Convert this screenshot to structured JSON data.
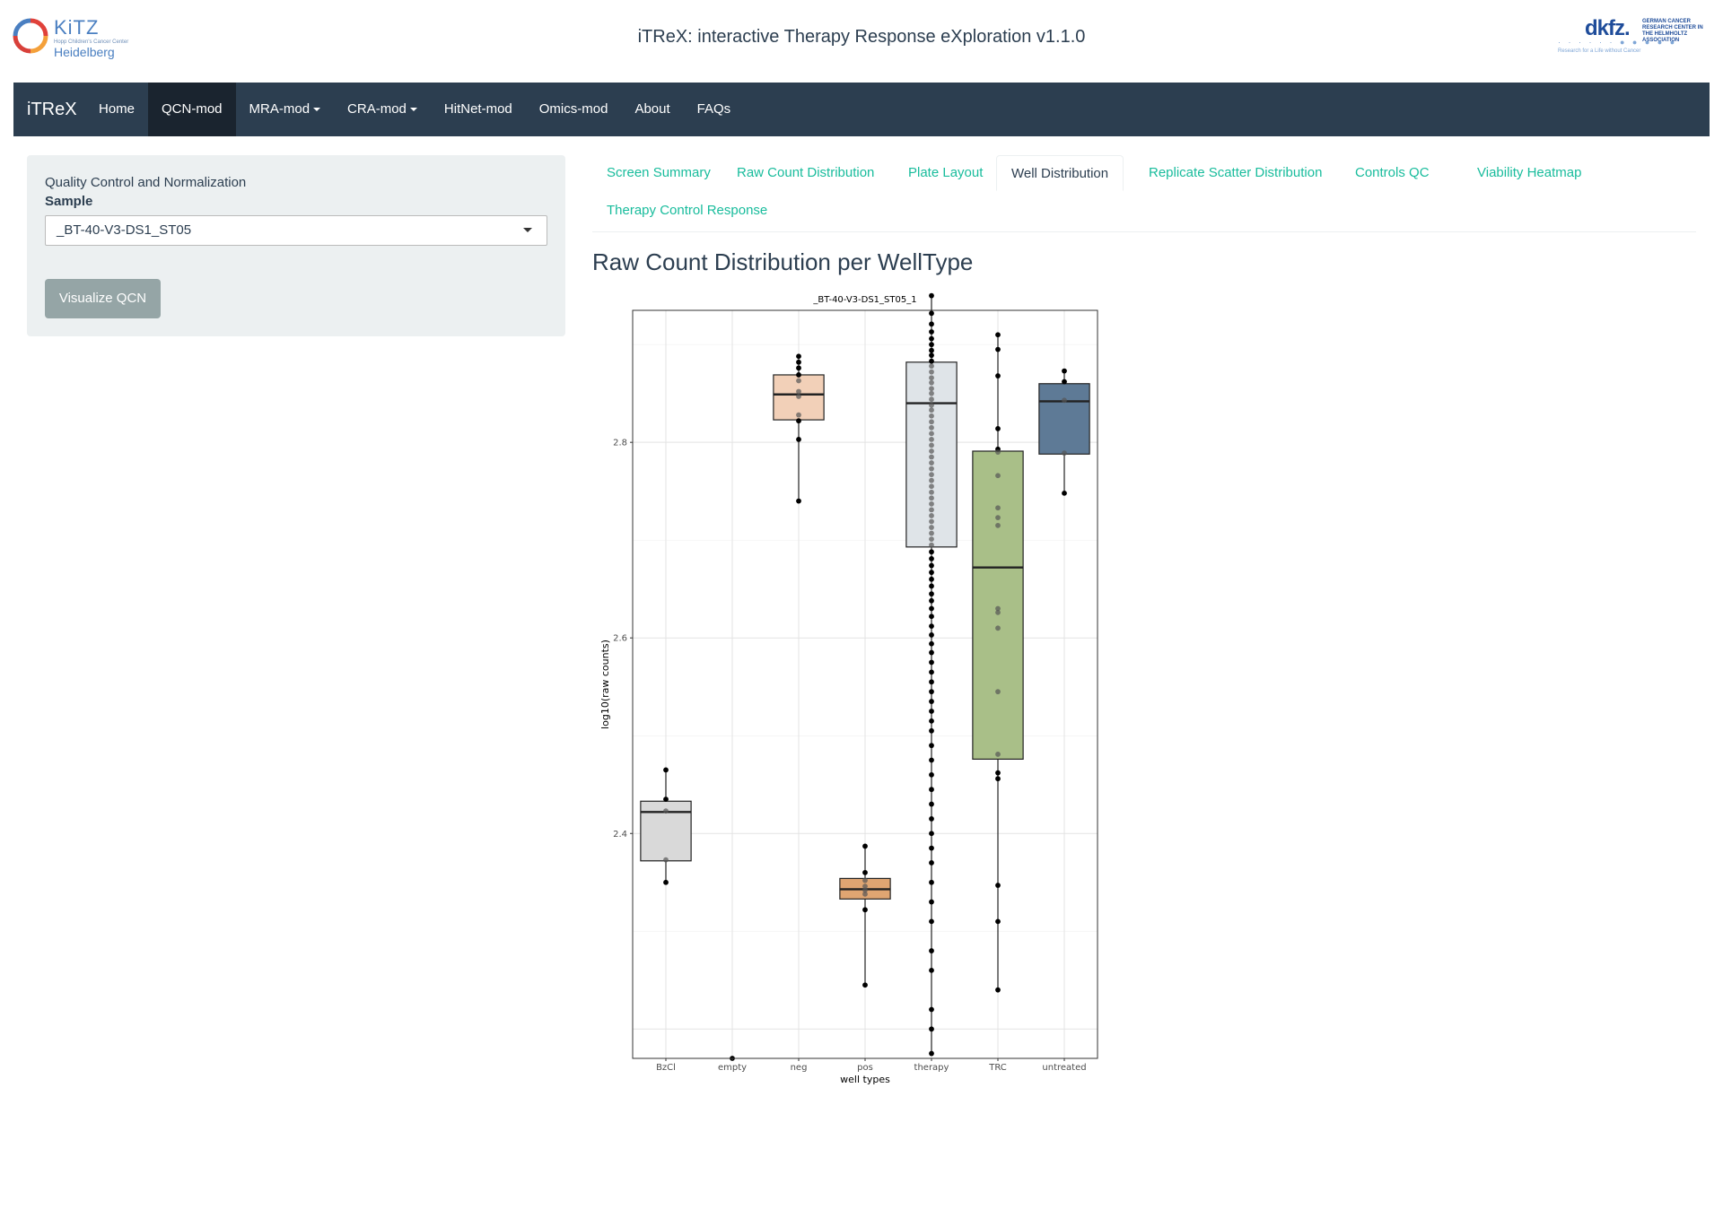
{
  "header": {
    "title": "iTReX: interactive Therapy Response eXploration v1.1.0",
    "kitz_logo": {
      "name": "KiTZ",
      "subtitle": "Hopp Children's Cancer Center",
      "city": "Heidelberg"
    },
    "dkfz_logo": {
      "name": "dkfz.",
      "org": "GERMAN CANCER RESEARCH CENTER IN THE HELMHOLTZ ASSOCIATION",
      "tagline": "Research for a Life without Cancer"
    }
  },
  "navbar": {
    "brand": "iTReX",
    "items": [
      {
        "label": "Home",
        "active": false,
        "dropdown": false
      },
      {
        "label": "QCN-mod",
        "active": true,
        "dropdown": false
      },
      {
        "label": "MRA-mod",
        "active": false,
        "dropdown": true
      },
      {
        "label": "CRA-mod",
        "active": false,
        "dropdown": true
      },
      {
        "label": "HitNet-mod",
        "active": false,
        "dropdown": false
      },
      {
        "label": "Omics-mod",
        "active": false,
        "dropdown": false
      },
      {
        "label": "About",
        "active": false,
        "dropdown": false
      },
      {
        "label": "FAQs",
        "active": false,
        "dropdown": false
      }
    ]
  },
  "sidebar": {
    "heading": "Quality Control and Normalization",
    "sample_label": "Sample",
    "sample_value": "_BT-40-V3-DS1_ST05",
    "button_label": "Visualize QCN"
  },
  "tabs": [
    {
      "label": "Screen Summary",
      "active": false
    },
    {
      "label": "Raw Count Distribution",
      "active": false
    },
    {
      "label": "Plate Layout",
      "active": false
    },
    {
      "label": "Well Distribution",
      "active": true
    },
    {
      "label": "Replicate Scatter Distribution",
      "active": false
    },
    {
      "label": "Controls QC",
      "active": false
    },
    {
      "label": "Viability Heatmap",
      "active": false
    },
    {
      "label": "Therapy Control Response",
      "active": false
    }
  ],
  "section_title": "Raw Count Distribution per WellType",
  "colors": {
    "navbar": "#2c3e50",
    "navbar_active": "#1a242f",
    "tab_link": "#18bc9c",
    "sidebar_bg": "#ecf0f1",
    "button_bg": "#95a5a6"
  },
  "chart_data": {
    "type": "box",
    "title": "_BT-40-V3-DS1_ST05_1",
    "xlabel": "well types",
    "ylabel": "log10(raw counts)",
    "ylim": [
      2.17,
      2.935
    ],
    "yticks": [
      "2.4",
      "2.6",
      "2.8"
    ],
    "grid": true,
    "categories": [
      "BzCl",
      "empty",
      "neg",
      "pos",
      "therapy",
      "TRC",
      "untreated"
    ],
    "boxes": [
      {
        "category": "BzCl",
        "whisker_low": 2.35,
        "q1": 2.372,
        "median": 2.422,
        "q3": 2.433,
        "whisker_high": 2.465,
        "color": "#d9d9d9",
        "points": [
          2.465,
          2.435,
          2.423,
          2.373,
          2.35
        ]
      },
      {
        "category": "empty",
        "points": [
          2.17
        ],
        "color": "#cccccc"
      },
      {
        "category": "neg",
        "whisker_low": 2.74,
        "q1": 2.823,
        "median": 2.849,
        "q3": 2.869,
        "whisker_high": 2.888,
        "color": "#f2d0b8",
        "points": [
          2.888,
          2.882,
          2.876,
          2.869,
          2.863,
          2.852,
          2.847,
          2.828,
          2.822,
          2.803,
          2.74
        ]
      },
      {
        "category": "pos",
        "whisker_low": 2.245,
        "q1": 2.333,
        "median": 2.343,
        "q3": 2.354,
        "whisker_high": 2.387,
        "color": "#dfa572",
        "points": [
          2.387,
          2.36,
          2.352,
          2.346,
          2.342,
          2.338,
          2.322,
          2.245
        ]
      },
      {
        "category": "therapy",
        "whisker_low": 2.175,
        "q1": 2.693,
        "median": 2.84,
        "q3": 2.882,
        "whisker_high": 2.95,
        "color": "#dfe4e8",
        "points": [
          2.95,
          2.932,
          2.921,
          2.913,
          2.906,
          2.9,
          2.894,
          2.889,
          2.883,
          2.878,
          2.872,
          2.866,
          2.861,
          2.855,
          2.85,
          2.844,
          2.838,
          2.833,
          2.827,
          2.821,
          2.815,
          2.809,
          2.803,
          2.797,
          2.791,
          2.785,
          2.779,
          2.773,
          2.767,
          2.761,
          2.755,
          2.749,
          2.743,
          2.737,
          2.731,
          2.725,
          2.719,
          2.713,
          2.707,
          2.701,
          2.695,
          2.688,
          2.681,
          2.674,
          2.667,
          2.66,
          2.653,
          2.645,
          2.638,
          2.63,
          2.622,
          2.612,
          2.603,
          2.594,
          2.585,
          2.575,
          2.565,
          2.555,
          2.545,
          2.535,
          2.525,
          2.515,
          2.505,
          2.49,
          2.475,
          2.46,
          2.445,
          2.43,
          2.415,
          2.4,
          2.385,
          2.37,
          2.35,
          2.33,
          2.31,
          2.28,
          2.26,
          2.22,
          2.2,
          2.175
        ]
      },
      {
        "category": "TRC",
        "whisker_low": 2.24,
        "q1": 2.476,
        "median": 2.672,
        "q3": 2.791,
        "whisker_high": 2.91,
        "color": "#a9bf88",
        "points": [
          2.91,
          2.895,
          2.868,
          2.814,
          2.793,
          2.79,
          2.766,
          2.733,
          2.723,
          2.715,
          2.63,
          2.626,
          2.61,
          2.545,
          2.481,
          2.462,
          2.456,
          2.347,
          2.31,
          2.24
        ]
      },
      {
        "category": "untreated",
        "whisker_low": 2.748,
        "q1": 2.788,
        "median": 2.842,
        "q3": 2.86,
        "whisker_high": 2.873,
        "color": "#5e7a96",
        "points": [
          2.873,
          2.862,
          2.843,
          2.789,
          2.748
        ]
      }
    ]
  }
}
